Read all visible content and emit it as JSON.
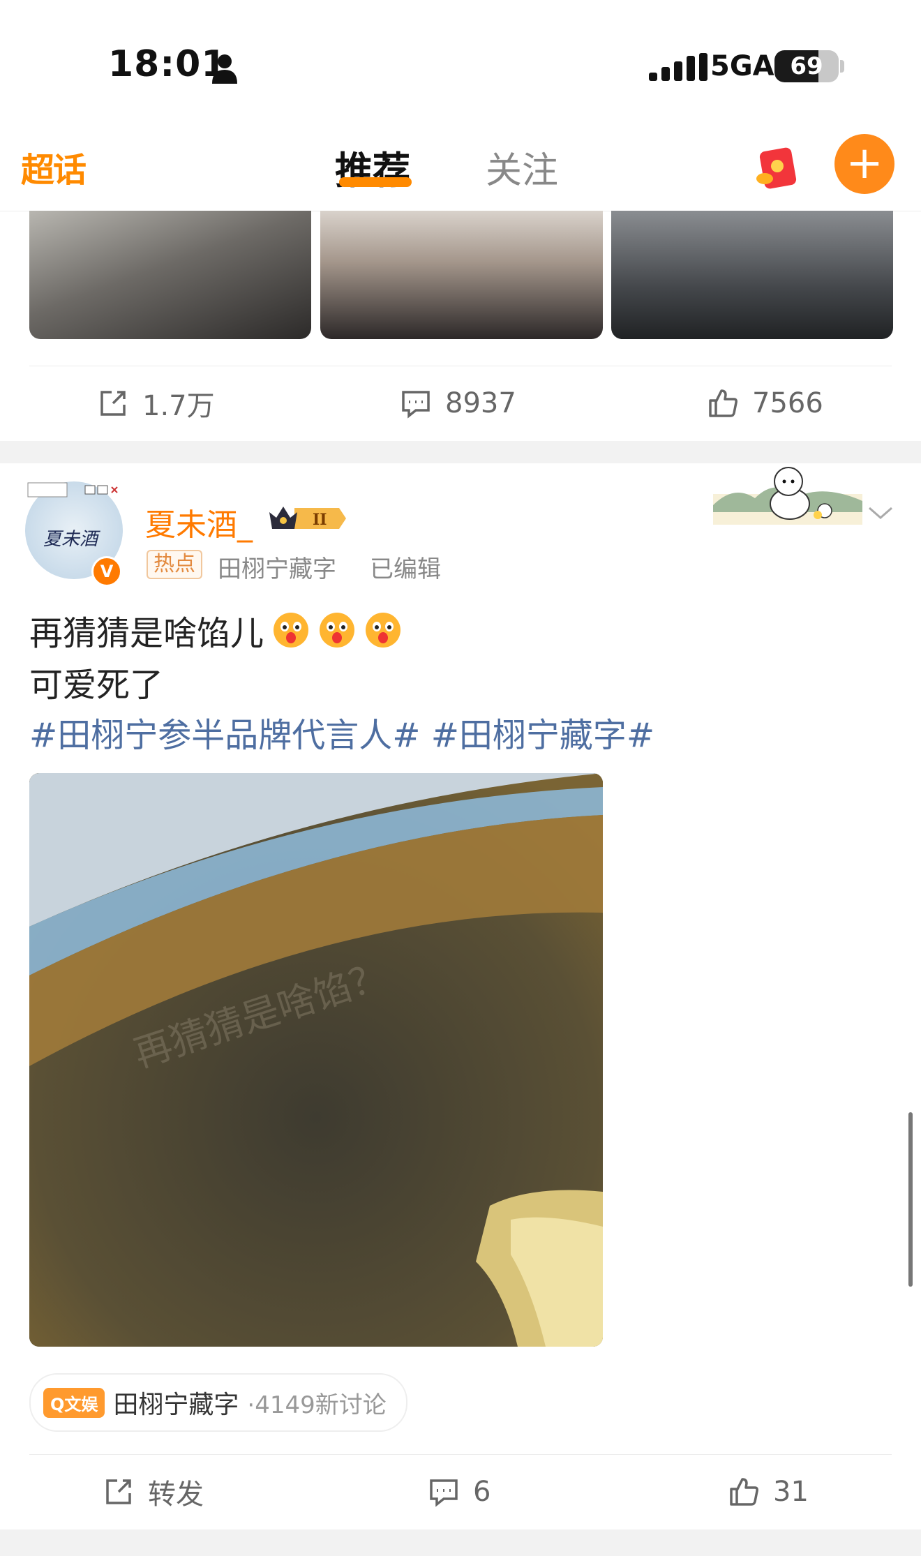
{
  "status_bar": {
    "time": "18:01",
    "network": "5GA",
    "battery": "69",
    "battery_level": 0.69
  },
  "nav": {
    "logo": "超话",
    "tabs": [
      {
        "label": "推荐",
        "active": true
      },
      {
        "label": "关注",
        "active": false
      }
    ],
    "accent_color": "#ff8a00"
  },
  "prev_post": {
    "repost_count": "1.7万",
    "comment_count": "8937",
    "like_count": "7566"
  },
  "post": {
    "avatar_text": "夏未酒",
    "username": "夏未酒_",
    "hot_tag": "热点",
    "topic_source": "田栩宁藏字",
    "edited_label": "已编辑",
    "text_line1": "再猜猜是啥馅儿",
    "text_line2": "可爱死了",
    "hashtags": "#田栩宁参半品牌代言人# #田栩宁藏字#",
    "image_watermark": "再猜猜是啥馅？",
    "topic_chip": {
      "badge": "Q文娱",
      "name": "田栩宁藏字",
      "count": "·4149新讨论"
    },
    "actions": {
      "repost_label": "转发",
      "comment_count": "6",
      "like_count": "31"
    }
  }
}
